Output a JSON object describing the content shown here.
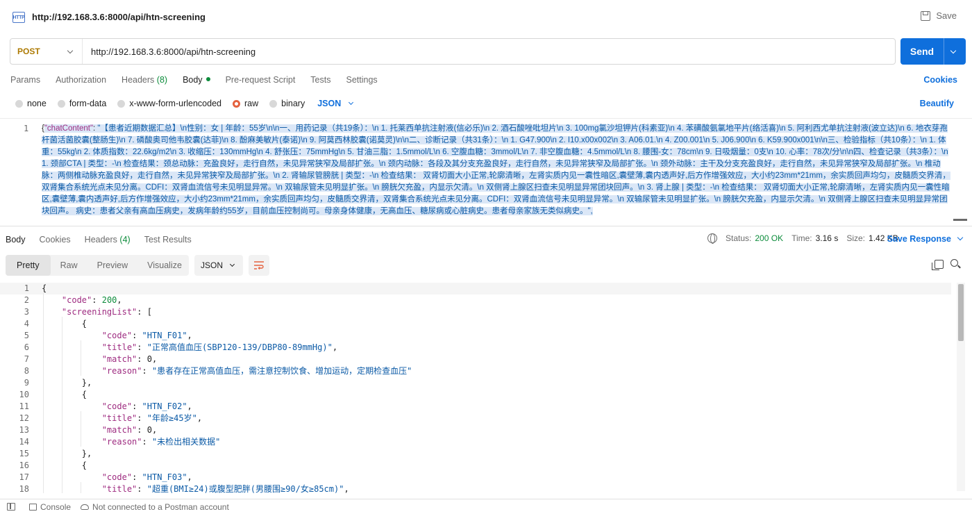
{
  "tab": {
    "title": "http://192.168.3.6:8000/api/htn-screening",
    "icon": "http-icon",
    "save_label": "Save"
  },
  "request": {
    "method": "POST",
    "url": "http://192.168.3.6:8000/api/htn-screening",
    "send_label": "Send",
    "tabs": [
      "Params",
      "Authorization",
      "Headers",
      "Body",
      "Pre-request Script",
      "Tests",
      "Settings"
    ],
    "headers_count": "(8)",
    "cookies_label": "Cookies",
    "body_types": [
      "none",
      "form-data",
      "x-www-form-urlencoded",
      "raw",
      "binary"
    ],
    "body_format": "JSON",
    "beautify_label": "Beautify",
    "editor_line": "1",
    "body_key": "\"chatContent\"",
    "body_value": "\"【患者近期数据汇总】\\n性别：女 | 年龄：55岁\\n\\n一、用药记录（共19条）：\\n  1. 托莱西单抗注射液(信必乐)\\n  2. 酒石酸唑吡坦片\\n  3. 100mg氯沙坦钾片(科素亚)\\n  4. 苯磺酸氨氯地平片(络活喜)\\n  5. 阿利西尤单抗注射液(波立达)\\n  6. 地衣芽孢杆菌活菌胶囊(整肠生)\\n  7. 磷酸奥司他韦胶囊(达菲)\\n  8. 酚麻美敏片(泰诺)\\n  9. 阿莫西林胶囊(诺莫灵)\\n\\n二、诊断记录（共31条）：\\n  1. G47.900\\n  2. I10.x00x002\\n  3. A06.01.\\n  4. Z00.001\\n  5. J06.900\\n  6. K59.900x001\\n\\n三、检验指标（共10条）：\\n  1. 体重：55kg\\n  2. 体质指数：22.6kg/m2\\n  3. 收缩压：130mmHg\\n  4. 舒张压：75mmHg\\n  5. 甘油三脂：1.5mmol/L\\n  6. 空腹血糖：3mmol/L\\n  7. 非空腹血糖：4.5mmol/L\\n  8. 腰围-女：78cm\\n  9. 日吸烟量：0支\\n  10. 心率：78次/分\\n\\n四、检查记录（共3条）：\\n  1. 颈部CTA | 类型：-\\n    检查结果：颈总动脉：充盈良好，走行自然，未见异常狭窄及局部扩张。\\n    颈内动脉：各段及其分支充盈良好，走行自然，未见异常狭窄及局部扩张。\\n    颈外动脉：主干及分支充盈良好，走行自然，未见异常狭窄及局部扩张。\\n    椎动脉：两侧椎动脉充盈良好，走行自然，未见异常狭窄及局部扩张。\\n  2. 肾输尿管膀胱 | 类型：-\\n    检查结果：    双肾切面大小正常,轮廓清晰，左肾实质内见一囊性暗区,囊壁薄,囊内透声好,后方作增强效应，大小约23mm*21mm，余实质回声均匀，皮髓质交界清，双肾集合系统光点未见分离。CDFI：双肾血流信号未见明显异常。\\n       双输尿管未见明显扩张。\\n       膀胱欠充盈，内显示欠清。\\n       双侧肾上腺区扫查未见明显异常团块回声。\\n  3. 肾上腺 | 类型：-\\n    检查结果：    双肾切面大小正常,轮廓清晰，左肾实质内见一囊性暗区,囊壁薄,囊内透声好,后方作增强效应，大小约23mm*21mm，余实质回声均匀，皮髓质交界清，双肾集合系统光点未见分离。CDFI：双肾血流信号未见明显异常。\\n       双输尿管未见明显扩张。\\n       膀胱欠充盈，内显示欠清。\\n       双侧肾上腺区扫查未见明显异常团块回声。  病史：患者父亲有高血压病史，发病年龄约55岁，目前血压控制尚可。母亲身体健康，无高血压、糖尿病或心脏病史。患者母亲家族无类似病史。\","
  },
  "response": {
    "tabs": [
      "Body",
      "Cookies",
      "Headers",
      "Test Results"
    ],
    "headers_count": "(4)",
    "status_label": "Status:",
    "status_value": "200 OK",
    "time_label": "Time:",
    "time_value": "3.16 s",
    "size_label": "Size:",
    "size_value": "1.42 KB",
    "save_response_label": "Save Response",
    "views": [
      "Pretty",
      "Raw",
      "Preview",
      "Visualize"
    ],
    "format": "JSON",
    "lines": [
      {
        "n": "1",
        "indent": 0,
        "parts": [
          [
            "p",
            "{"
          ]
        ]
      },
      {
        "n": "2",
        "indent": 1,
        "parts": [
          [
            "k",
            "\"code\""
          ],
          [
            "p",
            ": "
          ],
          [
            "num",
            "200"
          ],
          [
            "p",
            ","
          ]
        ]
      },
      {
        "n": "3",
        "indent": 1,
        "parts": [
          [
            "k",
            "\"screeningList\""
          ],
          [
            "p",
            ": ["
          ]
        ]
      },
      {
        "n": "4",
        "indent": 2,
        "parts": [
          [
            "p",
            "{"
          ]
        ]
      },
      {
        "n": "5",
        "indent": 3,
        "parts": [
          [
            "k",
            "\"code\""
          ],
          [
            "p",
            ": "
          ],
          [
            "s",
            "\"HTN_F01\""
          ],
          [
            "p",
            ","
          ]
        ]
      },
      {
        "n": "6",
        "indent": 3,
        "parts": [
          [
            "k",
            "\"title\""
          ],
          [
            "p",
            ": "
          ],
          [
            "s",
            "\"正常高值血压(SBP120-139/DBP80-89mmHg)\""
          ],
          [
            "p",
            ","
          ]
        ]
      },
      {
        "n": "7",
        "indent": 3,
        "parts": [
          [
            "k",
            "\"match\""
          ],
          [
            "p",
            ": "
          ],
          [
            "num0",
            "0"
          ],
          [
            "p",
            ","
          ]
        ]
      },
      {
        "n": "8",
        "indent": 3,
        "parts": [
          [
            "k",
            "\"reason\""
          ],
          [
            "p",
            ": "
          ],
          [
            "s",
            "\"患者存在正常高值血压，需注意控制饮食、增加运动，定期检查血压\""
          ]
        ]
      },
      {
        "n": "9",
        "indent": 2,
        "parts": [
          [
            "p",
            "},"
          ]
        ]
      },
      {
        "n": "10",
        "indent": 2,
        "parts": [
          [
            "p",
            "{"
          ]
        ]
      },
      {
        "n": "11",
        "indent": 3,
        "parts": [
          [
            "k",
            "\"code\""
          ],
          [
            "p",
            ": "
          ],
          [
            "s",
            "\"HTN_F02\""
          ],
          [
            "p",
            ","
          ]
        ]
      },
      {
        "n": "12",
        "indent": 3,
        "parts": [
          [
            "k",
            "\"title\""
          ],
          [
            "p",
            ": "
          ],
          [
            "s",
            "\"年龄≥45岁\""
          ],
          [
            "p",
            ","
          ]
        ]
      },
      {
        "n": "13",
        "indent": 3,
        "parts": [
          [
            "k",
            "\"match\""
          ],
          [
            "p",
            ": "
          ],
          [
            "num0",
            "0"
          ],
          [
            "p",
            ","
          ]
        ]
      },
      {
        "n": "14",
        "indent": 3,
        "parts": [
          [
            "k",
            "\"reason\""
          ],
          [
            "p",
            ": "
          ],
          [
            "s",
            "\"未检出相关数据\""
          ]
        ]
      },
      {
        "n": "15",
        "indent": 2,
        "parts": [
          [
            "p",
            "},"
          ]
        ]
      },
      {
        "n": "16",
        "indent": 2,
        "parts": [
          [
            "p",
            "{"
          ]
        ]
      },
      {
        "n": "17",
        "indent": 3,
        "parts": [
          [
            "k",
            "\"code\""
          ],
          [
            "p",
            ": "
          ],
          [
            "s",
            "\"HTN_F03\""
          ],
          [
            "p",
            ","
          ]
        ]
      },
      {
        "n": "18",
        "indent": 3,
        "parts": [
          [
            "k",
            "\"title\""
          ],
          [
            "p",
            ": "
          ],
          [
            "s",
            "\"超重(BMI≥24)或腹型肥胖(男腰围≥90/女≥85cm)\""
          ],
          [
            "p",
            ","
          ]
        ]
      }
    ]
  },
  "statusbar": {
    "console_label": "Console",
    "account_label": "Not connected to a Postman account"
  },
  "colors": {
    "accent": "#0f6fdc",
    "success": "#0c8c3b",
    "method": "#ad7a03",
    "json_key": "#9e2b80",
    "json_string": "#0b5aa6"
  }
}
